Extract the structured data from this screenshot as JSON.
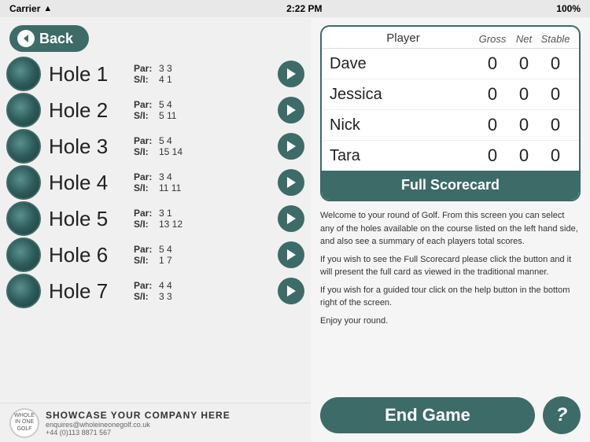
{
  "status_bar": {
    "carrier": "Carrier",
    "time": "2:22 PM",
    "battery": "100%"
  },
  "back_button": {
    "label": "Back"
  },
  "holes": [
    {
      "id": 1,
      "name": "Hole 1",
      "par_label": "Par:",
      "par_values": "3  3",
      "si_label": "S/I:",
      "si_values": "4  1"
    },
    {
      "id": 2,
      "name": "Hole 2",
      "par_label": "Par:",
      "par_values": "5  4",
      "si_label": "S/I:",
      "si_values": "5  11"
    },
    {
      "id": 3,
      "name": "Hole 3",
      "par_label": "Par:",
      "par_values": "5  4",
      "si_label": "S/I:",
      "si_values": "15  14"
    },
    {
      "id": 4,
      "name": "Hole 4",
      "par_label": "Par:",
      "par_values": "3  4",
      "si_label": "S/I:",
      "si_values": "11  11"
    },
    {
      "id": 5,
      "name": "Hole 5",
      "par_label": "Par:",
      "par_values": "3  1",
      "si_label": "S/I:",
      "si_values": "13  12"
    },
    {
      "id": 6,
      "name": "Hole 6",
      "par_label": "Par:",
      "par_values": "5  4",
      "si_label": "S/I:",
      "si_values": "1  7"
    },
    {
      "id": 7,
      "name": "Hole 7",
      "par_label": "Par:",
      "par_values": "4  4",
      "si_label": "S/I:",
      "si_values": "3  3"
    }
  ],
  "sponsor": {
    "name": "SHOWCASE YOUR COMPANY HERE",
    "email": "enquires@wholeineonegolf.co.uk",
    "phone": "+44 (0)113 8871 567",
    "logo_text": "WHOLE\nIN ONE\nGOLF"
  },
  "scoreboard": {
    "headers": {
      "player": "Player",
      "gross": "Gross",
      "net": "Net",
      "stable": "Stable"
    },
    "players": [
      {
        "name": "Dave",
        "gross": "0",
        "net": "0",
        "stable": "0"
      },
      {
        "name": "Jessica",
        "gross": "0",
        "net": "0",
        "stable": "0"
      },
      {
        "name": "Nick",
        "gross": "0",
        "net": "0",
        "stable": "0"
      },
      {
        "name": "Tara",
        "gross": "0",
        "net": "0",
        "stable": "0"
      }
    ],
    "full_scorecard_label": "Full Scorecard"
  },
  "description": {
    "para1": "Welcome to your round of Golf. From this screen you can select any of the holes available on the course listed on the left hand side, and also see a summary of each players total scores.",
    "para2": "If you wish to see the Full Scorecard please click the button and it will present the full card as viewed in the traditional manner.",
    "para3": "If you wish for a guided tour click on the help button in the bottom right of the screen.",
    "para4": "Enjoy your round."
  },
  "buttons": {
    "end_game": "End Game",
    "help": "?"
  }
}
